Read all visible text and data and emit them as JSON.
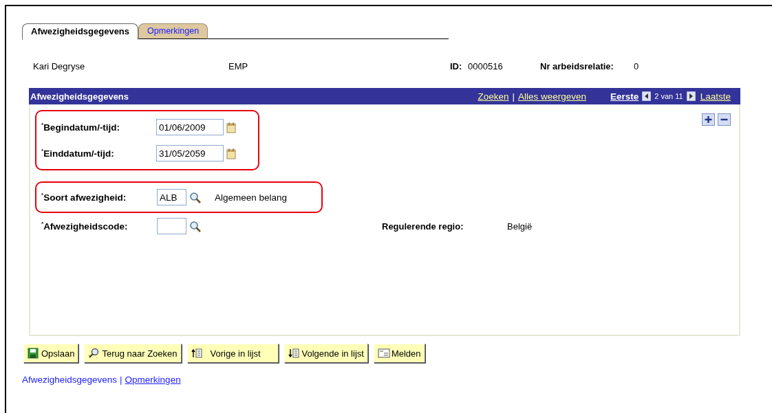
{
  "tabs": [
    {
      "label": "Afwezigheidsgegevens",
      "selected": true
    },
    {
      "label": "Opmerkingen",
      "selected": false
    }
  ],
  "header": {
    "name": "Kari Degryse",
    "type": "EMP",
    "id_label": "ID:",
    "id": "0000516",
    "relation_label": "Nr arbeidsrelatie:",
    "relation": "0"
  },
  "panel": {
    "title": "Afwezigheidsgegevens",
    "links": [
      "Zoeken",
      "Alles weergeven"
    ],
    "link_separator": "|",
    "first": "Eerste",
    "counter": "2 van 11",
    "last": "Laatste",
    "field_groups": [
      {
        "highlighted": true,
        "fields": [
          {
            "kind": "date",
            "label": "$^{*}$Begindatum/-tijd:",
            "value": "01/06/2009"
          },
          {
            "kind": "date",
            "label": "$^{*}$Einddatum/-tijd:",
            "value": "31/05/2059"
          }
        ]
      },
      {
        "highlighted": true,
        "fields": [
          {
            "kind": "lookup",
            "label": "$^{*}$Soort afwezigheid:",
            "value": "ALB",
            "description": "Algemeen belang"
          }
        ]
      },
      {
        "highlighted": false,
        "fields": [
          {
            "kind": "lookup",
            "label": "$^{*}$Afwezigheidscode:",
            "aside_label": "Regulerende regio:",
            "aside_value": "België"
          }
        ]
      }
    ]
  },
  "buttons": [
    {
      "kind": "save",
      "label": "Opslaan"
    },
    {
      "kind": "search",
      "label": "Terug naar Zoeken"
    },
    {
      "kind": "previous",
      "label": "Vorige in lijst"
    },
    {
      "kind": "next",
      "label": "Volgende in lijst"
    },
    {
      "kind": "notify",
      "label": "Melden"
    }
  ],
  "footer_separator": "|",
  "footer_links": [
    {
      "label": "Afwezigheidsgegevens",
      "selected": true
    },
    {
      "label": "Opmerkingen",
      "selected": false
    }
  ]
}
